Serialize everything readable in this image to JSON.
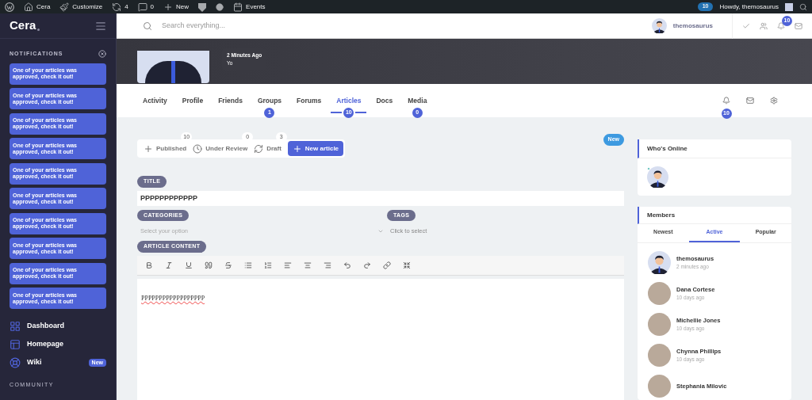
{
  "admin_bar": {
    "items": [
      {
        "kind": "wp"
      },
      {
        "kind": "site",
        "label": "Cera"
      },
      {
        "kind": "customize",
        "label": "Customize"
      },
      {
        "kind": "updates",
        "label": "4"
      },
      {
        "kind": "comments",
        "label": "0"
      },
      {
        "kind": "new",
        "label": "New"
      },
      {
        "kind": "plugin"
      },
      {
        "kind": "dot"
      },
      {
        "kind": "events",
        "label": "Events"
      }
    ],
    "badge": "10",
    "greeting": "Howdy, themosaurus"
  },
  "sidebar": {
    "logo": "Cera",
    "notifications_title": "NOTIFICATIONS",
    "notifications": [
      "One of your articles was approved, check it out!",
      "One of your articles was approved, check it out!",
      "One of your articles was approved, check it out!",
      "One of your articles was approved, check it out!",
      "One of your articles was approved, check it out!",
      "One of your articles was approved, check it out!",
      "One of your articles was approved, check it out!",
      "One of your articles was approved, check it out!",
      "One of your articles was approved, check it out!",
      "One of your articles was approved, check it out!"
    ],
    "nav": [
      {
        "kind": "dashboard",
        "label": "Dashboard"
      },
      {
        "kind": "homepage",
        "label": "Homepage"
      },
      {
        "kind": "wiki",
        "label": "Wiki",
        "badge": "New"
      }
    ],
    "section": "COMMUNITY"
  },
  "header": {
    "search_placeholder": "Search everything...",
    "user": "themosaurus",
    "notifications_badge": "10"
  },
  "cover": {
    "time": "2 Minutes Ago",
    "text": "Yo"
  },
  "profile_tabs": [
    {
      "label": "Activity",
      "selected": false
    },
    {
      "label": "Profile",
      "selected": false
    },
    {
      "label": "Friends",
      "selected": false
    },
    {
      "label": "Groups",
      "selected": false,
      "count": "1"
    },
    {
      "label": "Forums",
      "selected": false
    },
    {
      "label": "Articles",
      "selected": true,
      "count": "10"
    },
    {
      "label": "Docs",
      "selected": false
    },
    {
      "label": "Media",
      "selected": false,
      "count": "0"
    }
  ],
  "profile_actions": {
    "notifications_badge": "10"
  },
  "article_tabs": [
    {
      "kind": "published",
      "label": "Published",
      "count": "10",
      "selected": false
    },
    {
      "kind": "review",
      "label": "Under Review",
      "count": "0",
      "selected": false
    },
    {
      "kind": "draft",
      "label": "Draft",
      "count": "3",
      "selected": false
    },
    {
      "kind": "new",
      "label": "New article",
      "selected": true
    }
  ],
  "new_badge": "New",
  "form": {
    "title_label": "TITLE",
    "title_value": "PPPPPPPPPPPP",
    "categories_label": "CATEGORIES",
    "categories_placeholder": "Select your option",
    "tags_label": "TAGS",
    "tags_placeholder": "Click to select",
    "content_label": "ARTICLE CONTENT",
    "content": "PPPPPPPPPPPPPPPPPP"
  },
  "whos_online": {
    "title": "Who's Online"
  },
  "members": {
    "title": "Members",
    "tabs": [
      {
        "label": "Newest",
        "selected": false
      },
      {
        "label": "Active",
        "selected": true
      },
      {
        "label": "Popular",
        "selected": false
      }
    ],
    "list": [
      {
        "name": "themosaurus",
        "time": "2 minutes ago",
        "kind": "illustration"
      },
      {
        "name": "Dana Cortese",
        "time": "10 days ago",
        "kind": "photo"
      },
      {
        "name": "Michellie Jones",
        "time": "10 days ago",
        "kind": "photo"
      },
      {
        "name": "Chynna Phillips",
        "time": "10 days ago",
        "kind": "photo"
      },
      {
        "name": "Stephania Milovic",
        "kind": "photo"
      }
    ]
  }
}
